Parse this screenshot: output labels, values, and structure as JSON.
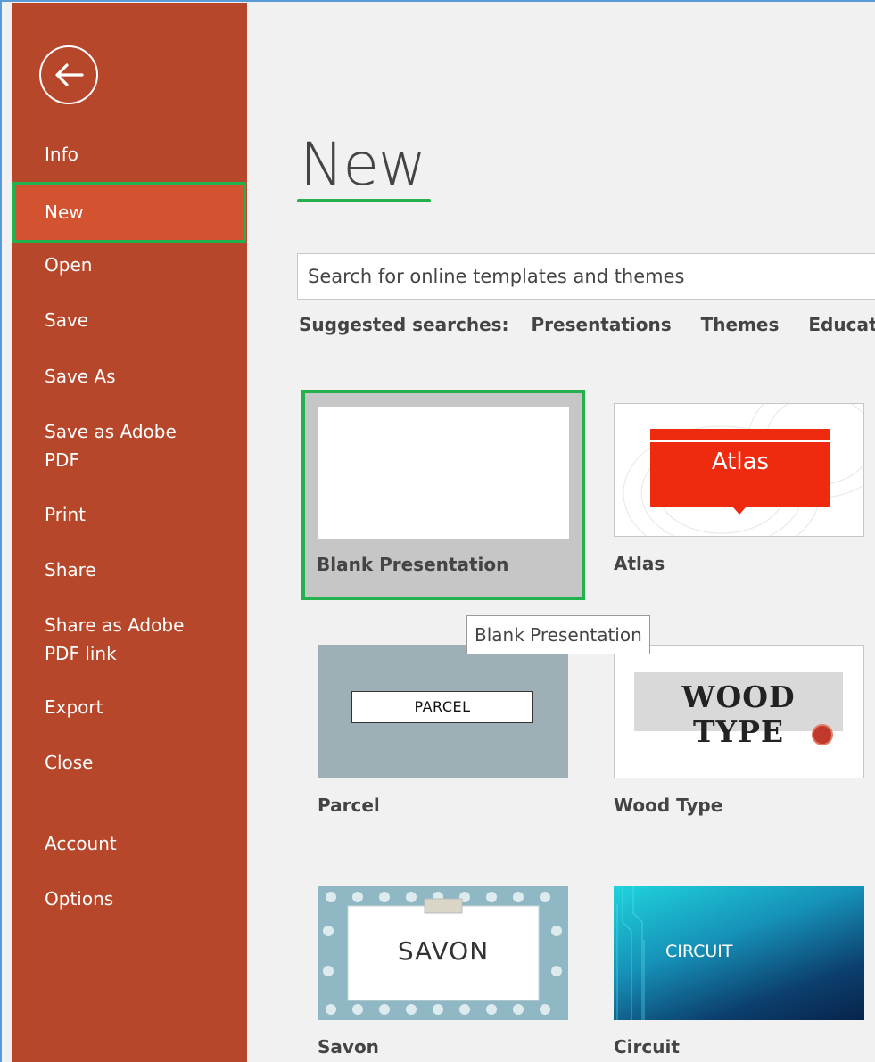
{
  "sidebar": {
    "items": [
      {
        "label": "Info"
      },
      {
        "label": "New"
      },
      {
        "label": "Open"
      },
      {
        "label": "Save"
      },
      {
        "label": "Save As"
      },
      {
        "label": "Save as Adobe PDF"
      },
      {
        "label": "Print"
      },
      {
        "label": "Share"
      },
      {
        "label": "Share as Adobe PDF link"
      },
      {
        "label": "Export"
      },
      {
        "label": "Close"
      },
      {
        "label": "Account"
      },
      {
        "label": "Options"
      }
    ],
    "active_item": "New",
    "back_icon": "back-arrow-icon"
  },
  "main": {
    "title": "New",
    "search_placeholder": "Search for online templates and themes",
    "suggested": {
      "label": "Suggested searches:",
      "links": [
        "Presentations",
        "Themes",
        "Educati"
      ]
    },
    "templates": [
      {
        "name": "Blank Presentation"
      },
      {
        "name": "Atlas",
        "thumb_text": "Atlas"
      },
      {
        "name": "Parcel",
        "thumb_text": "PARCEL"
      },
      {
        "name": "Wood Type",
        "thumb_text": "WOOD TYPE"
      },
      {
        "name": "Savon",
        "thumb_text": "SAVON"
      },
      {
        "name": "Circuit",
        "thumb_text": "CIRCUIT"
      }
    ],
    "tooltip": "Blank Presentation"
  },
  "colors": {
    "sidebar_bg": "#b7472a",
    "sidebar_active": "#d35230",
    "highlight": "#22b14c",
    "atlas_red": "#ee2b0f"
  }
}
